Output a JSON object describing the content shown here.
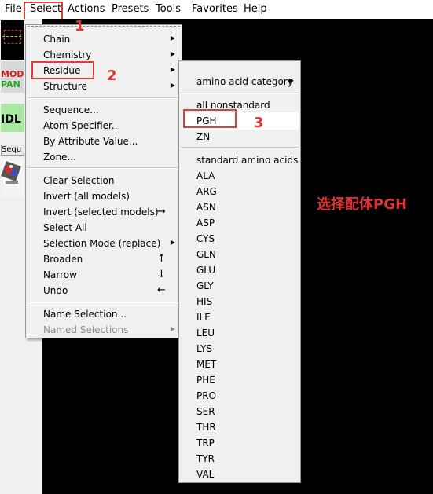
{
  "menubar": {
    "items": [
      "File",
      "Select",
      "Actions",
      "Presets",
      "Tools",
      "Favorites",
      "Help"
    ]
  },
  "left_panel": {
    "labels": [
      "MOD",
      "PAN",
      "IDL",
      "Sequ"
    ]
  },
  "select_menu": {
    "items": [
      {
        "label": "Chain"
      },
      {
        "label": "Chemistry"
      },
      {
        "label": "Residue"
      },
      {
        "label": "Structure"
      },
      {
        "label": "Sequence..."
      },
      {
        "label": "Atom Specifier..."
      },
      {
        "label": "By Attribute Value..."
      },
      {
        "label": "Zone..."
      },
      {
        "label": "Clear Selection"
      },
      {
        "label": "Invert (all models)"
      },
      {
        "label": "Invert (selected models)",
        "shortcut": "→"
      },
      {
        "label": "Select All"
      },
      {
        "label": "Selection Mode (replace)"
      },
      {
        "label": "Broaden",
        "shortcut": "↑"
      },
      {
        "label": "Narrow",
        "shortcut": "↓"
      },
      {
        "label": "Undo",
        "shortcut": "←"
      },
      {
        "label": "Name Selection..."
      },
      {
        "label": "Named Selections"
      }
    ]
  },
  "residue_submenu": {
    "category": "amino acid category",
    "nonstandard_header": "all nonstandard",
    "nonstandard": [
      "PGH",
      "ZN"
    ],
    "standard_header": "standard amino acids",
    "standard": [
      "ALA",
      "ARG",
      "ASN",
      "ASP",
      "CYS",
      "GLN",
      "GLU",
      "GLY",
      "HIS",
      "ILE",
      "LEU",
      "LYS",
      "MET",
      "PHE",
      "PRO",
      "SER",
      "THR",
      "TRP",
      "TYR",
      "VAL"
    ]
  },
  "annotations": {
    "step1": "1",
    "step2": "2",
    "step3": "3",
    "note": "选择配体PGH",
    "color": "#e03232"
  },
  "icons": [
    "submenu-arrow-icon",
    "chimera-logo-icon"
  ]
}
